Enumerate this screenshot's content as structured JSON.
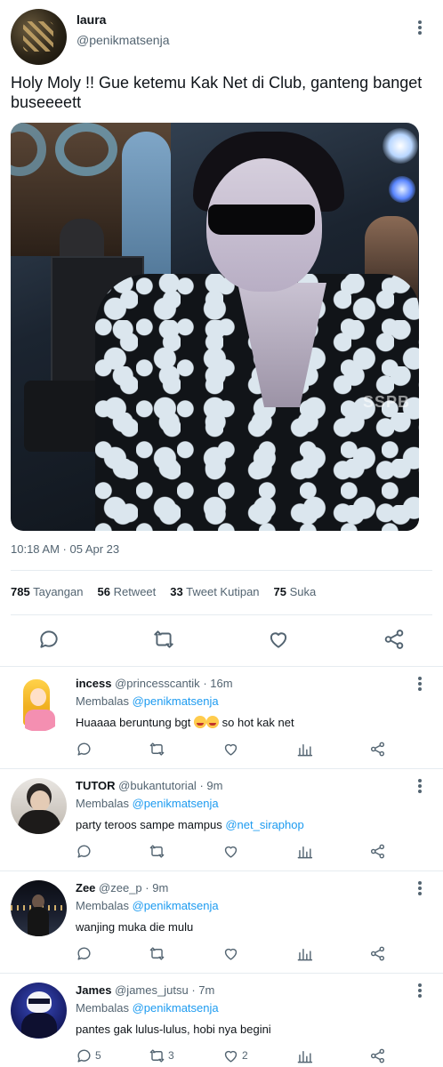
{
  "main": {
    "display_name": "laura",
    "handle": "@penikmatsenja",
    "text": "Holy Moly !! Gue ketemu Kak Net di Club, ganteng banget buseeeett",
    "image_watermark": "SSPB",
    "timestamp": "10:18 AM · 05 Apr 23",
    "stats": [
      {
        "value": "785",
        "label": "Tayangan"
      },
      {
        "value": "56",
        "label": "Retweet"
      },
      {
        "value": "33",
        "label": "Tweet Kutipan"
      },
      {
        "value": "75",
        "label": "Suka"
      }
    ],
    "actions": [
      "reply-icon",
      "retweet-icon",
      "like-icon",
      "share-icon"
    ]
  },
  "reply_prefix": "Membalas",
  "replies": [
    {
      "display_name": "incess",
      "handle": "@princesscantik",
      "age": "· 16m",
      "replying_to": "@penikmatsenja",
      "text": "Huaaaa beruntung bgt",
      "text_suffix": "so hot kak net",
      "counts": {
        "reply": "",
        "retweet": "",
        "like": ""
      }
    },
    {
      "display_name": "TUTOR",
      "handle": "@bukantutorial",
      "age": "· 9m",
      "replying_to": "@penikmatsenja",
      "text": "party teroos sampe mampus",
      "mention": "@net_siraphop",
      "counts": {
        "reply": "",
        "retweet": "",
        "like": ""
      }
    },
    {
      "display_name": "Zee",
      "handle": "@zee_p",
      "age": "· 9m",
      "replying_to": "@penikmatsenja",
      "text": "wanjing muka die mulu",
      "counts": {
        "reply": "",
        "retweet": "",
        "like": ""
      }
    },
    {
      "display_name": "James",
      "handle": "@james_jutsu",
      "age": "· 7m",
      "replying_to": "@penikmatsenja",
      "text": "pantes gak lulus-lulus, hobi nya begini",
      "counts": {
        "reply": "5",
        "retweet": "3",
        "like": "2"
      }
    }
  ],
  "colors": {
    "text": "#0f1419",
    "muted": "#536471",
    "link": "#1d9bf0",
    "divider": "#e6ecf0"
  }
}
